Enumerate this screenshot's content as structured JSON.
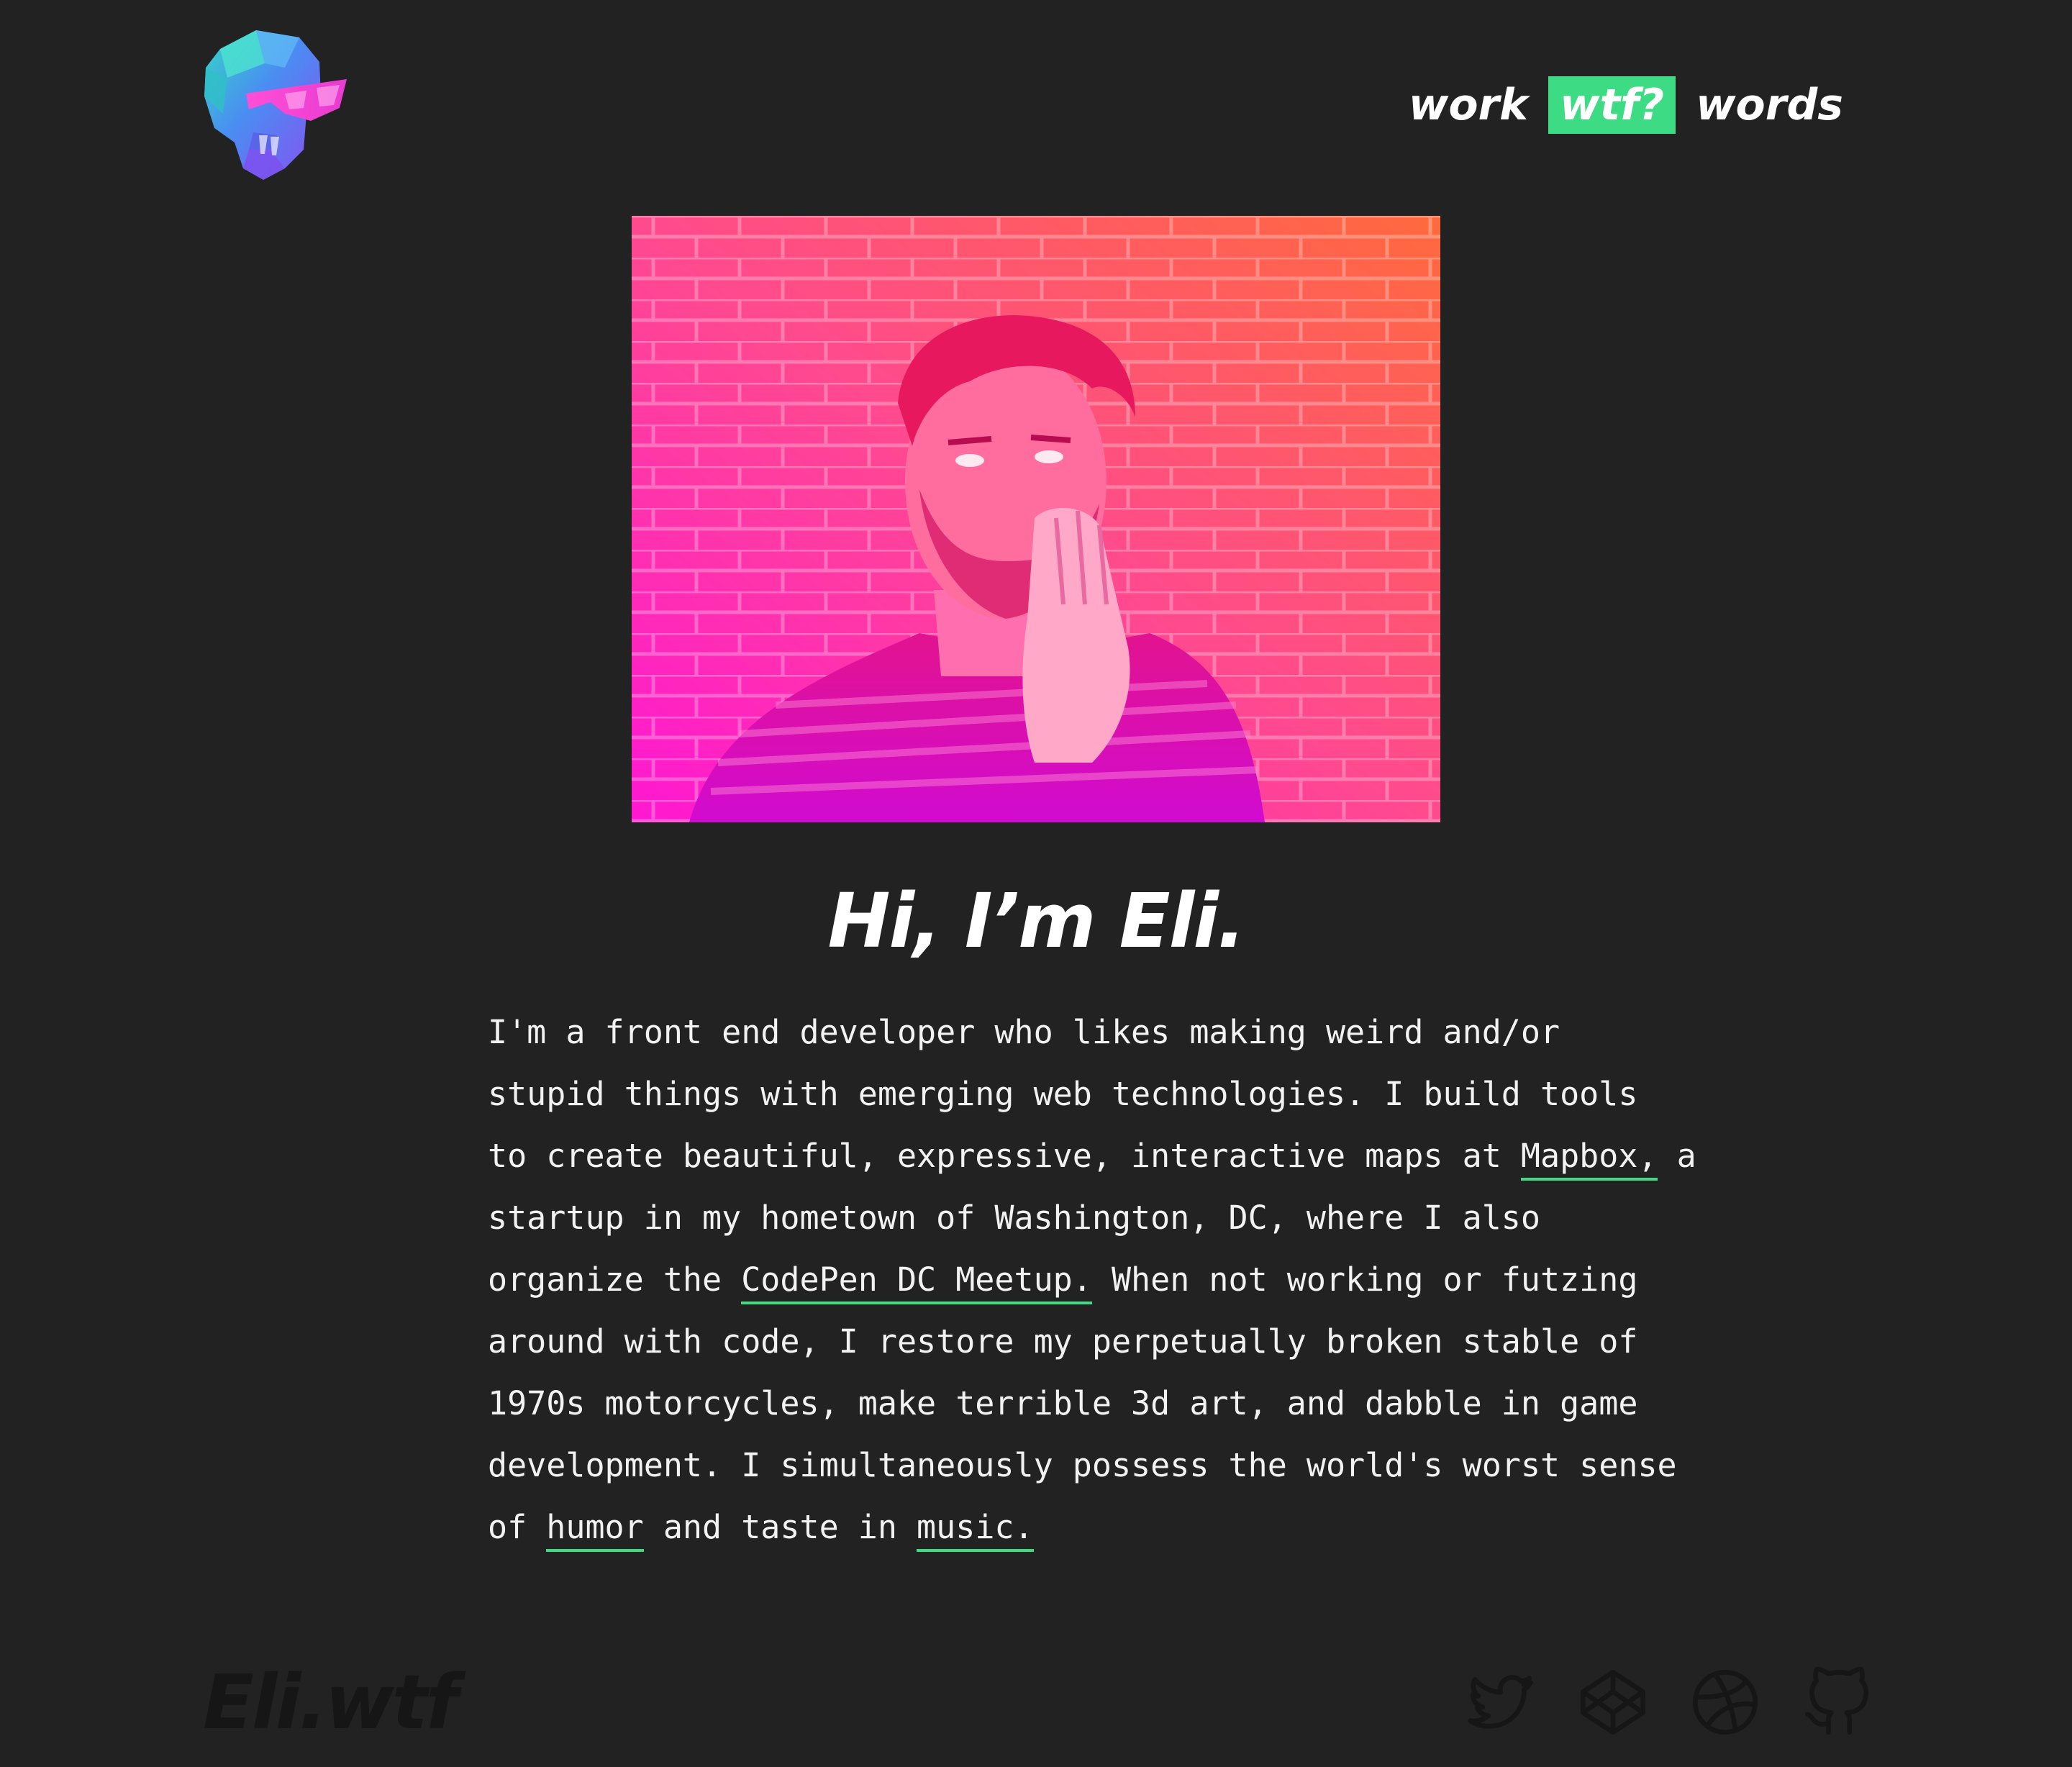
{
  "header": {
    "logo_icon": "low-poly-skull-with-sunglasses-icon",
    "nav": [
      {
        "label": "work",
        "active": false
      },
      {
        "label": "wtf?",
        "active": true
      },
      {
        "label": "words",
        "active": false
      }
    ]
  },
  "hero": {
    "photo_description_icon": "portrait-photo"
  },
  "intro": {
    "headline": "Hi, I’m Eli.",
    "bio_lines": {
      "l1": "I'm a front end developer who likes making weird and/or",
      "l2": "stupid things with emerging web technologies. I build tools",
      "l3_pre": "to create beautiful, expressive, interactive maps at ",
      "l3_link": "Mapbox,",
      "l3_post": " a",
      "l4": "startup in my hometown of Washington, DC, where I also",
      "l5_pre": "organize the ",
      "l5_link": "CodePen DC Meetup.",
      "l5_post": " When not working or futzing",
      "l6": "around with code, I restore my perpetually broken stable of",
      "l7": "1970s motorcycles, make terrible 3d art, and dabble in game",
      "l8": "development. I simultaneously possess the world's worst sense",
      "l9_pre": "of ",
      "l9_link1": "humor",
      "l9_mid": " and taste in ",
      "l9_link2": "music."
    }
  },
  "footer": {
    "wordmark": "Eli.wtf",
    "social": [
      {
        "name": "twitter-icon"
      },
      {
        "name": "codepen-icon"
      },
      {
        "name": "dribbble-icon"
      },
      {
        "name": "github-icon"
      }
    ]
  },
  "colors": {
    "background": "#222222",
    "accent": "#3ddc84",
    "text": "#ffffff",
    "footer_muted": "#161616"
  }
}
